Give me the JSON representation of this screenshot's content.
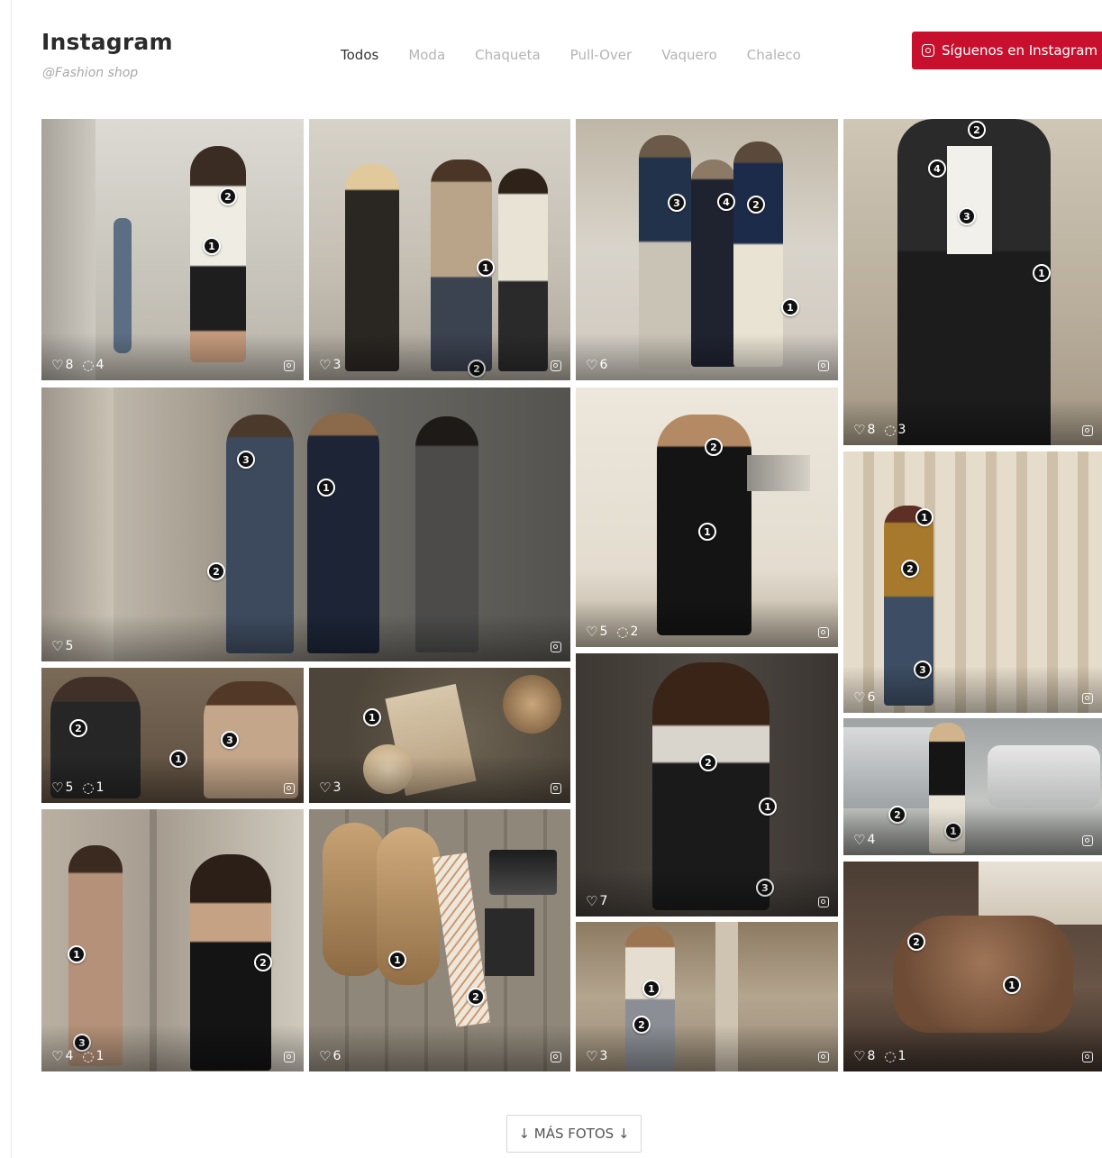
{
  "header": {
    "title": "Instagram",
    "handle": "@Fashion shop",
    "follow_label": "Síguenos en Instagram",
    "accent_color": "#c8102e"
  },
  "filters": [
    {
      "label": "Todos",
      "active": true
    },
    {
      "label": "Moda",
      "active": false
    },
    {
      "label": "Chaqueta",
      "active": false
    },
    {
      "label": "Pull-Over",
      "active": false
    },
    {
      "label": "Vaquero",
      "active": false
    },
    {
      "label": "Chaleco",
      "active": false
    }
  ],
  "posts": [
    {
      "likes": "8",
      "comments": "4",
      "hotspots": [
        "2",
        "1"
      ]
    },
    {
      "likes": "3",
      "comments": "",
      "hotspots": [
        "1",
        "2"
      ]
    },
    {
      "likes": "6",
      "comments": "",
      "hotspots": [
        "3",
        "4",
        "2",
        "1"
      ]
    },
    {
      "likes": "8",
      "comments": "3",
      "hotspots": [
        "2",
        "4",
        "3",
        "1"
      ]
    },
    {
      "likes": "5",
      "comments": "",
      "hotspots": [
        "3",
        "1",
        "2"
      ]
    },
    {
      "likes": "5",
      "comments": "2",
      "hotspots": [
        "2",
        "1"
      ]
    },
    {
      "likes": "6",
      "comments": "",
      "hotspots": [
        "1",
        "2",
        "3"
      ]
    },
    {
      "likes": "5",
      "comments": "1",
      "hotspots": [
        "2",
        "3",
        "1"
      ]
    },
    {
      "likes": "3",
      "comments": "",
      "hotspots": [
        "1"
      ]
    },
    {
      "likes": "7",
      "comments": "",
      "hotspots": [
        "2",
        "1",
        "3"
      ]
    },
    {
      "likes": "4",
      "comments": "",
      "hotspots": [
        "2",
        "1"
      ]
    },
    {
      "likes": "4",
      "comments": "1",
      "hotspots": [
        "1",
        "2",
        "3"
      ]
    },
    {
      "likes": "6",
      "comments": "",
      "hotspots": [
        "1",
        "2"
      ]
    },
    {
      "likes": "3",
      "comments": "",
      "hotspots": [
        "1",
        "2"
      ]
    },
    {
      "likes": "8",
      "comments": "1",
      "hotspots": [
        "2",
        "1"
      ]
    }
  ],
  "icons": {
    "like": "heart-icon",
    "comment": "comment-icon",
    "instagram": "instagram-icon"
  },
  "footer": {
    "more_label": "↓ MÁS FOTOS ↓"
  }
}
